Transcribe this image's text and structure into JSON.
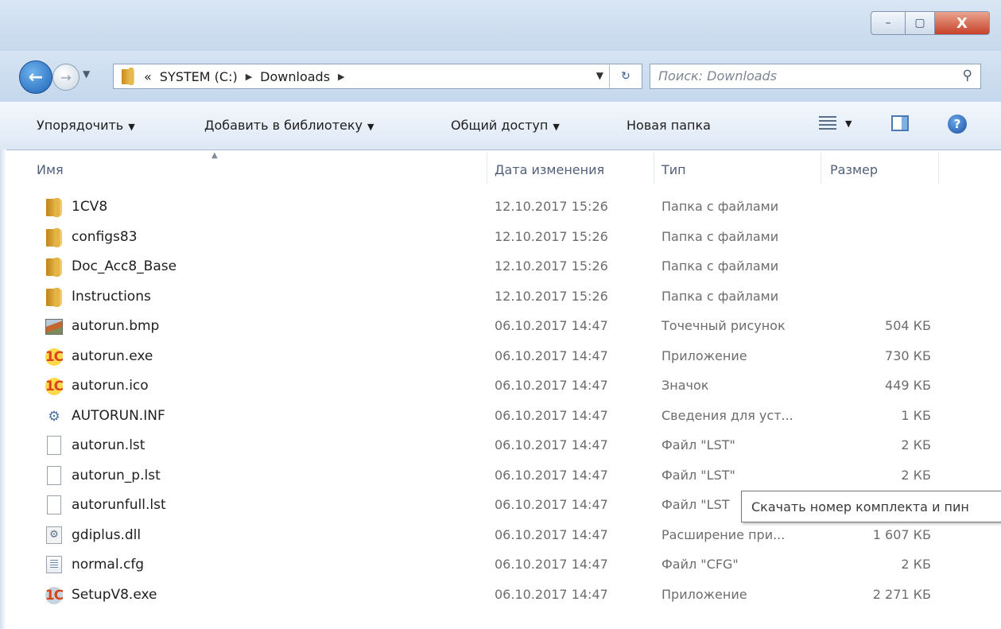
{
  "window": {
    "controls": {
      "minimize": "–",
      "maximize": "▢",
      "close": "X"
    }
  },
  "nav": {
    "back_glyph": "←",
    "forward_glyph": "→",
    "history_glyph": "▼"
  },
  "address": {
    "overflow": "«",
    "crumbs": [
      "SYSTEM (C:)",
      "Downloads"
    ],
    "separator": "▶",
    "dropdown_glyph": "▼",
    "refresh_glyph": "↻"
  },
  "search": {
    "placeholder": "Поиск: Downloads",
    "icon_glyph": "⚲"
  },
  "toolbar": {
    "organize": "Упорядочить",
    "add_to_library": "Добавить в библиотеку",
    "share": "Общий доступ",
    "new_folder": "Новая папка",
    "dropdown_glyph": "▼",
    "help_glyph": "?"
  },
  "columns": {
    "name": "Имя",
    "date": "Дата изменения",
    "type": "Тип",
    "size": "Размер"
  },
  "files": [
    {
      "name": "1CV8",
      "date": "12.10.2017 15:26",
      "type": "Папка с файлами",
      "size": "",
      "icon": "folder"
    },
    {
      "name": "configs83",
      "date": "12.10.2017 15:26",
      "type": "Папка с файлами",
      "size": "",
      "icon": "folder"
    },
    {
      "name": "Doc_Acc8_Base",
      "date": "12.10.2017 15:26",
      "type": "Папка с файлами",
      "size": "",
      "icon": "folder"
    },
    {
      "name": "Instructions",
      "date": "12.10.2017 15:26",
      "type": "Папка с файлами",
      "size": "",
      "icon": "folder"
    },
    {
      "name": "autorun.bmp",
      "date": "06.10.2017 14:47",
      "type": "Точечный рисунок",
      "size": "504 КБ",
      "icon": "bmp"
    },
    {
      "name": "autorun.exe",
      "date": "06.10.2017 14:47",
      "type": "Приложение",
      "size": "730 КБ",
      "icon": "onec"
    },
    {
      "name": "autorun.ico",
      "date": "06.10.2017 14:47",
      "type": "Значок",
      "size": "449 КБ",
      "icon": "onec"
    },
    {
      "name": "AUTORUN.INF",
      "date": "06.10.2017 14:47",
      "type": "Сведения для уст...",
      "size": "1 КБ",
      "icon": "inf"
    },
    {
      "name": "autorun.lst",
      "date": "06.10.2017 14:47",
      "type": "Файл \"LST\"",
      "size": "2 КБ",
      "icon": "doc"
    },
    {
      "name": "autorun_p.lst",
      "date": "06.10.2017 14:47",
      "type": "Файл \"LST\"",
      "size": "2 КБ",
      "icon": "doc"
    },
    {
      "name": "autorunfull.lst",
      "date": "06.10.2017 14:47",
      "type": "Файл \"LST",
      "size": "",
      "icon": "doc"
    },
    {
      "name": "gdiplus.dll",
      "date": "06.10.2017 14:47",
      "type": "Расширение при...",
      "size": "1 607 КБ",
      "icon": "dll"
    },
    {
      "name": "normal.cfg",
      "date": "06.10.2017 14:47",
      "type": "Файл \"CFG\"",
      "size": "2 КБ",
      "icon": "cfg"
    },
    {
      "name": "SetupV8.exe",
      "date": "06.10.2017 14:47",
      "type": "Приложение",
      "size": "2 271 КБ",
      "icon": "setup"
    }
  ],
  "tooltip": "Скачать номер комплекта и пин"
}
